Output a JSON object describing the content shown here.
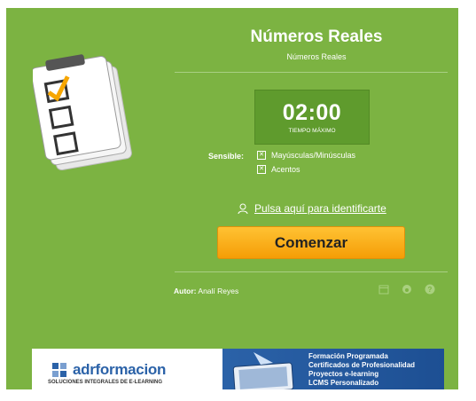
{
  "header": {
    "title": "Números Reales",
    "subtitle": "Números Reales"
  },
  "timer": {
    "time": "02:00",
    "label": "TIEMPO MÁXIMO"
  },
  "sensitivity": {
    "label": "Sensible:",
    "options": [
      {
        "label": "Mayúsculas/Minúsculas",
        "checked": true
      },
      {
        "label": "Acentos",
        "checked": true
      }
    ]
  },
  "login": {
    "text": "Pulsa aquí para identificarte"
  },
  "start_button": {
    "label": "Comenzar"
  },
  "author": {
    "label": "Autor:",
    "name": "Analí Reyes"
  },
  "footer_icons": [
    "calendar-icon",
    "eye-icon",
    "help-icon"
  ],
  "banner": {
    "brand": "adrformacion",
    "tagline": "SOLUCIONES INTEGRALES DE E-LEARNING",
    "lines": [
      "Formación Programada",
      "Certificados de Profesionalidad",
      "Proyectos e-learning",
      "LCMS Personalizado"
    ]
  },
  "colors": {
    "panel": "#7cb342",
    "timer_box": "#5f9b2d",
    "button": "#f9a825",
    "banner_blue": "#2b62a8"
  }
}
